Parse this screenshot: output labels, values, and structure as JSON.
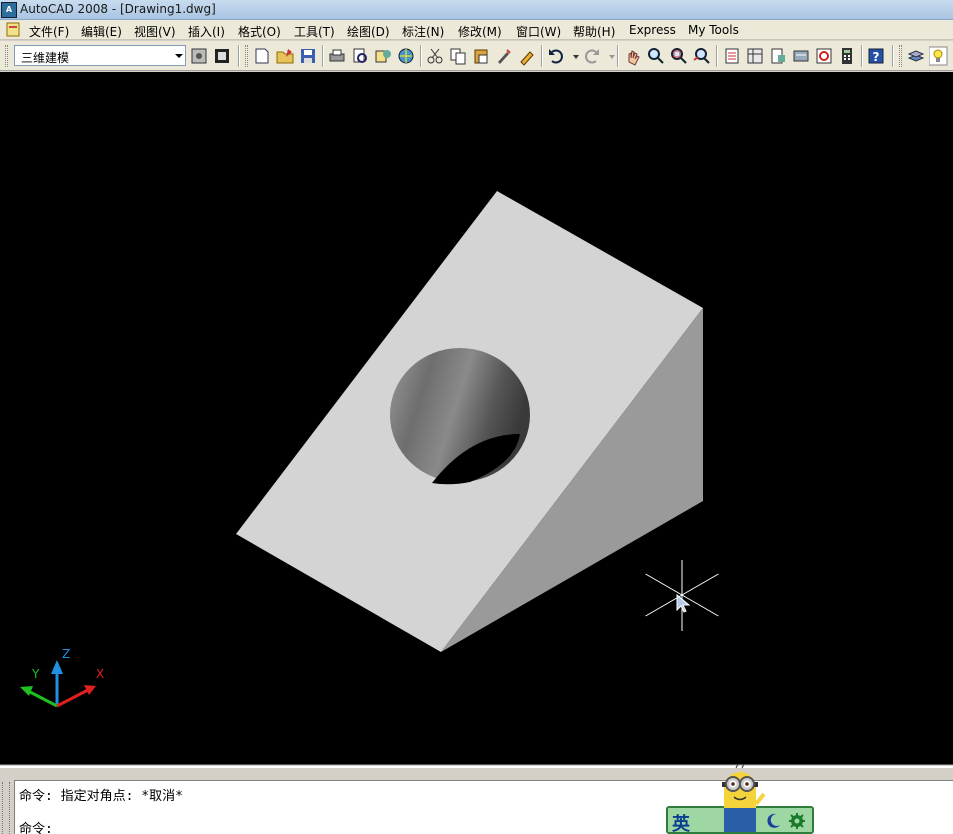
{
  "window": {
    "title": "AutoCAD 2008 - [Drawing1.dwg]",
    "app_icon_label": "A"
  },
  "menu": {
    "items": [
      {
        "label": "文件(F)"
      },
      {
        "label": "编辑(E)"
      },
      {
        "label": "视图(V)"
      },
      {
        "label": "插入(I)"
      },
      {
        "label": "格式(O)"
      },
      {
        "label": "工具(T)"
      },
      {
        "label": "绘图(D)"
      },
      {
        "label": "标注(N)"
      },
      {
        "label": "修改(M)"
      },
      {
        "label": "窗口(W)"
      },
      {
        "label": "帮助(H)"
      },
      {
        "label": "Express"
      },
      {
        "label": "My Tools"
      }
    ]
  },
  "toolbar": {
    "workspace_selected": "三维建模",
    "icons": [
      "workspace-settings-icon",
      "workspace-toggle-icon",
      "new-icon",
      "open-icon",
      "save-icon",
      "plot-icon",
      "plot-preview-icon",
      "publish-icon",
      "3d-dwf-icon",
      "cut-icon",
      "copy-icon",
      "paste-icon",
      "match-properties-icon",
      "block-editor-icon",
      "undo-icon",
      "redo-icon",
      "pan-icon",
      "zoom-realtime-icon",
      "zoom-window-icon",
      "zoom-previous-icon",
      "properties-icon",
      "design-center-icon",
      "tool-palettes-icon",
      "sheet-set-icon",
      "markup-icon",
      "calculator-icon",
      "help-icon",
      "layers-icon",
      "light-icon"
    ]
  },
  "viewport": {
    "background": "#000000",
    "model_face_top": "#d4d4d4",
    "model_face_side": "#9a9a9a",
    "ucs": {
      "x_label": "X",
      "y_label": "Y",
      "z_label": "Z",
      "x_color": "#e02020",
      "y_color": "#20c020",
      "z_color": "#2090e0"
    }
  },
  "command": {
    "history_line": "命令: 指定对角点: *取消*",
    "prompt_line": "命令:"
  },
  "ime": {
    "mode_label": "英"
  }
}
